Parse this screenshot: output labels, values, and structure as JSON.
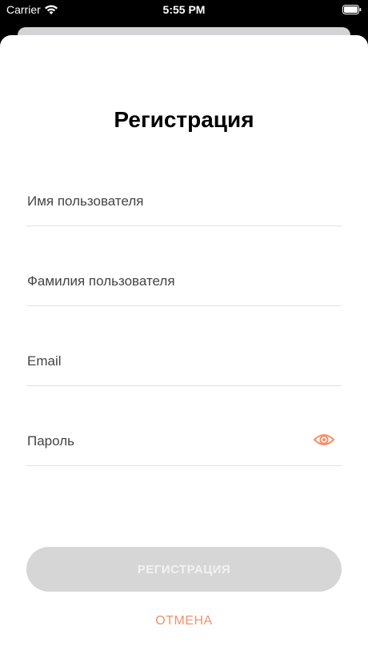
{
  "status_bar": {
    "carrier": "Carrier",
    "time": "5:55 PM",
    "icons": [
      "wifi-icon",
      "battery-icon"
    ]
  },
  "screen": {
    "title": "Регистрация",
    "fields": {
      "first_name": {
        "label": "Имя пользователя",
        "value": ""
      },
      "last_name": {
        "label": "Фамилия пользователя",
        "value": ""
      },
      "email": {
        "label": "Email",
        "value": ""
      },
      "password": {
        "label": "Пароль",
        "value": "",
        "toggle_icon": "eye-icon"
      }
    },
    "register_label": "РЕГИСТРАЦИЯ",
    "cancel_label": "ОТМЕНА"
  },
  "colors": {
    "accent": "#f0916b",
    "button_disabled_bg": "#d6d6d6",
    "button_disabled_text": "#f2f2f2",
    "divider": "#e2e2e2"
  }
}
